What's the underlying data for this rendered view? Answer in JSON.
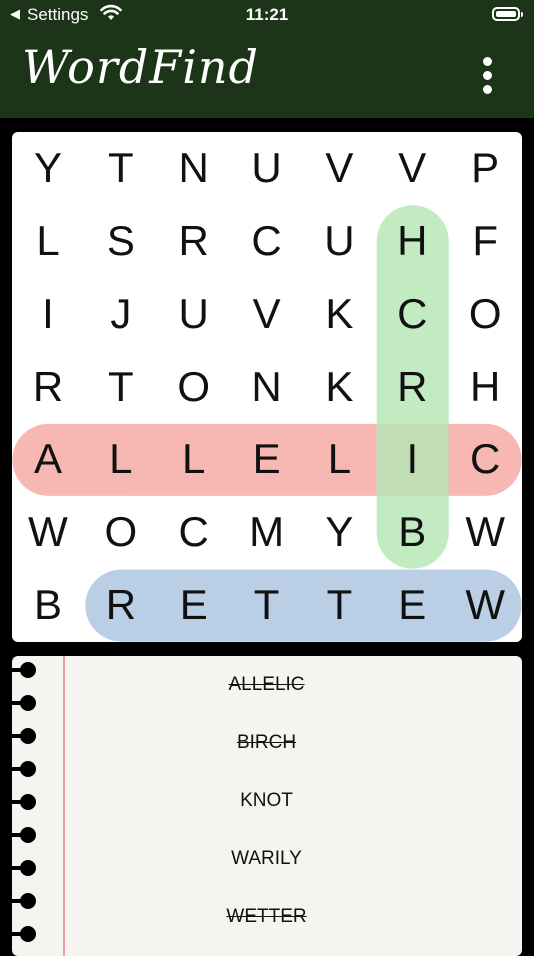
{
  "status_bar": {
    "back_label": "◀",
    "carrier": "Settings",
    "time": "11:21"
  },
  "header": {
    "title": "WordFind"
  },
  "grid": {
    "rows": [
      [
        "Y",
        "T",
        "N",
        "U",
        "V",
        "V",
        "P"
      ],
      [
        "L",
        "S",
        "R",
        "C",
        "U",
        "H",
        "F"
      ],
      [
        "I",
        "J",
        "U",
        "V",
        "K",
        "C",
        "O"
      ],
      [
        "R",
        "T",
        "O",
        "N",
        "K",
        "R",
        "H"
      ],
      [
        "A",
        "L",
        "L",
        "E",
        "L",
        "I",
        "C"
      ],
      [
        "W",
        "O",
        "C",
        "M",
        "Y",
        "B",
        "W"
      ],
      [
        "B",
        "R",
        "E",
        "T",
        "T",
        "E",
        "W"
      ]
    ],
    "highlights": [
      {
        "word": "ALLELIC",
        "color": "#f5a6a0",
        "from": [
          4,
          0
        ],
        "to": [
          4,
          6
        ]
      },
      {
        "word": "BIRCH",
        "color": "#b3e6b3",
        "from": [
          1,
          5
        ],
        "to": [
          5,
          5
        ]
      },
      {
        "word": "WETTER",
        "color": "#a9c3e0",
        "from": [
          6,
          1
        ],
        "to": [
          6,
          6
        ]
      }
    ]
  },
  "words": [
    {
      "text": "ALLELIC",
      "found": true
    },
    {
      "text": "BIRCH",
      "found": true
    },
    {
      "text": "KNOT",
      "found": false
    },
    {
      "text": "WARILY",
      "found": false
    },
    {
      "text": "WETTER",
      "found": true
    }
  ]
}
